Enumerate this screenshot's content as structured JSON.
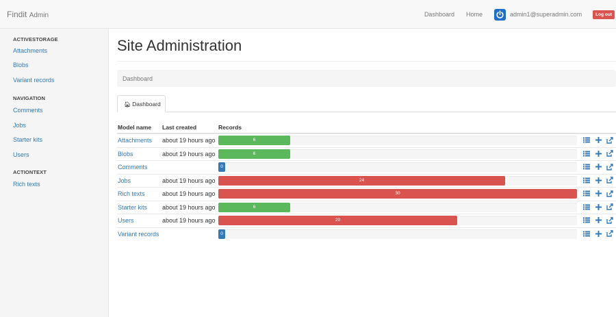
{
  "navbar": {
    "brand": "Findit",
    "brand_suffix": "Admin",
    "links": [
      "Dashboard",
      "Home"
    ],
    "user_email": "admin1@superadmin.com",
    "logout": "Log out"
  },
  "sidebar": {
    "groups": [
      {
        "heading": "ACTIVESTORAGE",
        "items": [
          "Attachments",
          "Blobs",
          "Variant records"
        ]
      },
      {
        "heading": "NAVIGATION",
        "items": [
          "Comments",
          "Jobs",
          "Starter kits",
          "Users"
        ]
      },
      {
        "heading": "ACTIONTEXT",
        "items": [
          "Rich texts"
        ]
      }
    ]
  },
  "main": {
    "title": "Site Administration",
    "breadcrumb": "Dashboard",
    "tab": "Dashboard",
    "table": {
      "headers": [
        "Model name",
        "Last created",
        "Records"
      ],
      "max_records": 30,
      "rows": [
        {
          "name": "Attachments",
          "last_created": "about 19 hours ago",
          "records": 6,
          "status": "success"
        },
        {
          "name": "Blobs",
          "last_created": "about 19 hours ago",
          "records": 6,
          "status": "success"
        },
        {
          "name": "Comments",
          "last_created": "",
          "records": 0,
          "status": "empty"
        },
        {
          "name": "Jobs",
          "last_created": "about 19 hours ago",
          "records": 24,
          "status": "danger"
        },
        {
          "name": "Rich texts",
          "last_created": "about 19 hours ago",
          "records": 30,
          "status": "danger"
        },
        {
          "name": "Starter kits",
          "last_created": "about 19 hours ago",
          "records": 6,
          "status": "success"
        },
        {
          "name": "Users",
          "last_created": "about 19 hours ago",
          "records": 20,
          "status": "danger"
        },
        {
          "name": "Variant records",
          "last_created": "",
          "records": 0,
          "status": "empty"
        }
      ]
    },
    "row_actions": [
      "list-icon",
      "plus-icon",
      "export-icon"
    ]
  },
  "colors": {
    "success": "#5cb85c",
    "danger": "#d9534f",
    "primary": "#337ab7",
    "avatar": "#1e6fc9"
  }
}
